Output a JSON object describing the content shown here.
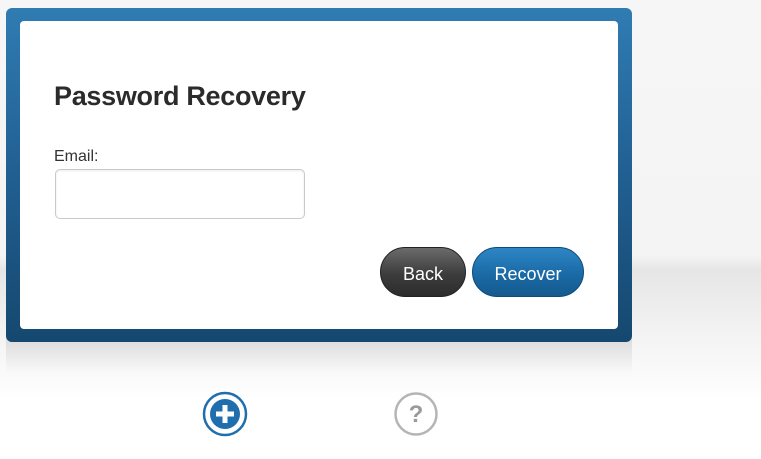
{
  "recovery": {
    "title": "Password Recovery",
    "email_label": "Email:",
    "email_value": "",
    "back_label": "Back",
    "recover_label": "Recover"
  },
  "footer": {
    "add_icon": "plus-circle-icon",
    "help_icon": "question-circle-icon",
    "colors": {
      "accent": "#1f6fae",
      "help_grey": "#b5b5b5"
    }
  }
}
